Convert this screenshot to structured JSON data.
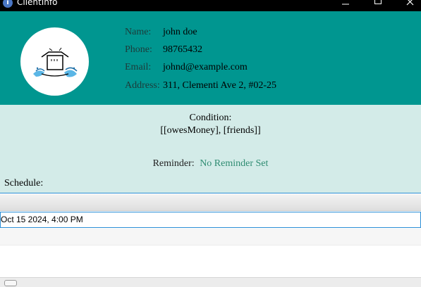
{
  "window": {
    "title": "ClientInfo",
    "icon": "info-icon"
  },
  "profile": {
    "name_label": "Name:",
    "name": "john doe",
    "phone_label": "Phone:",
    "phone": "98765432",
    "email_label": "Email:",
    "email": "johnd@example.com",
    "address_label": "Address:",
    "address": "311, Clementi Ave 2, #02-25"
  },
  "condition": {
    "label": "Condition:",
    "value": "[[owesMoney], [friends]]"
  },
  "reminder": {
    "label": "Reminder:",
    "value": "No Reminder Set"
  },
  "schedule": {
    "label": "Schedule:",
    "rows": [
      "Oct 15 2024, 4:00 PM",
      "",
      ""
    ]
  },
  "colors": {
    "header_bg": "#009690",
    "panel_bg": "#d3ebe8",
    "reminder_text": "#2f8c72",
    "selection_border": "#2b8ed6"
  }
}
